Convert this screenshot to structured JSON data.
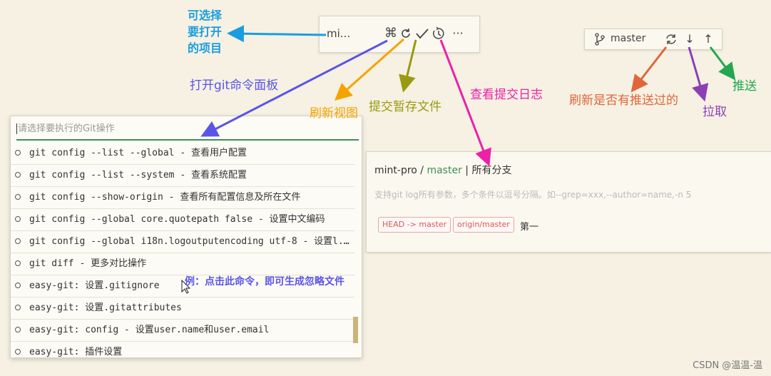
{
  "toolbar": {
    "project_name": "mi...",
    "icons": [
      "command-icon",
      "refresh-icon",
      "check-icon",
      "history-icon",
      "more-icon"
    ]
  },
  "branch_bar": {
    "branch": "master",
    "icons": [
      "branch-icon",
      "sync-icon",
      "pull-arrow-icon",
      "push-arrow-icon"
    ]
  },
  "palette": {
    "placeholder": "请选择要执行的Git操作",
    "items": [
      "git config --list --global - 查看用户配置",
      "git config --list --system - 查看系统配置",
      "git config --show-origin - 查看所有配置信息及所在文件",
      "git config --global core.quotepath false - 设置中文编码",
      "git config --global i18n.logoutputencoding utf-8 - 设置l...",
      "git diff - 更多对比操作",
      "easy-git: 设置.gitignore",
      "easy-git: 设置.gitattributes",
      "easy-git: config - 设置user.name和user.email",
      "easy-git: 插件设置"
    ]
  },
  "log_panel": {
    "project": "mint-pro",
    "separator": " / ",
    "branch": "master",
    "all_branches": " | 所有分支",
    "hint": "支持git log所有参数，多个条件以逗号分隔。如--grep=xxx,--author=name,-n 5",
    "tags": [
      "HEAD -> master",
      "origin/master"
    ],
    "commit_message": "第一"
  },
  "annotations": {
    "select_project": [
      "可选择",
      "要打开",
      "的项目"
    ],
    "open_command_panel": "打开git命令面板",
    "refresh_view": "刷新视图",
    "commit_staged": "提交暂存文件",
    "view_log": "查看提交日志",
    "refresh_pushed": "刷新是否有推送过的",
    "pull": "拉取",
    "push": "推送",
    "example": "例：点击此命令，即可生成忽略文件"
  },
  "watermark": "CSDN @温温-温",
  "colors": {
    "select_project": "#1a9de0",
    "open_command_panel": "#5a55e6",
    "refresh_view": "#f5a300",
    "commit_staged": "#9a9a10",
    "view_log": "#ee1fa8",
    "refresh_pushed": "#e0663a",
    "pull": "#8c3fb5",
    "push": "#22a84f",
    "example": "#5a55e6"
  }
}
